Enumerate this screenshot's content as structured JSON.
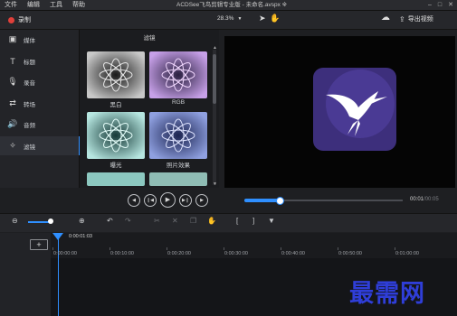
{
  "menu": [
    "文件",
    "编辑",
    "工具",
    "帮助"
  ],
  "window_title": "ACDSee飞鸟剪辑专业版 - 未命名.avspx ※",
  "record_label": "录制",
  "zoom_value": "28.3%",
  "export_label": "导出视频",
  "nav": [
    {
      "label": "媒体",
      "icon": "media-icon"
    },
    {
      "label": "标题",
      "icon": "title-icon"
    },
    {
      "label": "录音",
      "icon": "microphone-icon"
    },
    {
      "label": "转场",
      "icon": "transition-icon"
    },
    {
      "label": "音频",
      "icon": "audio-icon"
    },
    {
      "label": "滤镜",
      "icon": "magic-wand-icon"
    }
  ],
  "panel_title": "滤镜",
  "filters": [
    {
      "label": "黑白"
    },
    {
      "label": "RGB"
    },
    {
      "label": "曝光"
    },
    {
      "label": "照片效果"
    }
  ],
  "timecode": {
    "current": "00:01",
    "total": "00:05"
  },
  "playback_progress": 0.22,
  "playhead_time": "0:00:01:03",
  "ruler_ticks": [
    "0:00:00:00",
    "0:00:10:00",
    "0:00:20:00",
    "0:00:30:00",
    "0:00:40:00",
    "0:00:50:00",
    "0:01:00:00"
  ],
  "watermark": "最需网",
  "colors": {
    "accent": "#2f8fff",
    "record": "#e0403a",
    "logo_bg": "#3d2f7c",
    "watermark": "#2f3ed8"
  }
}
